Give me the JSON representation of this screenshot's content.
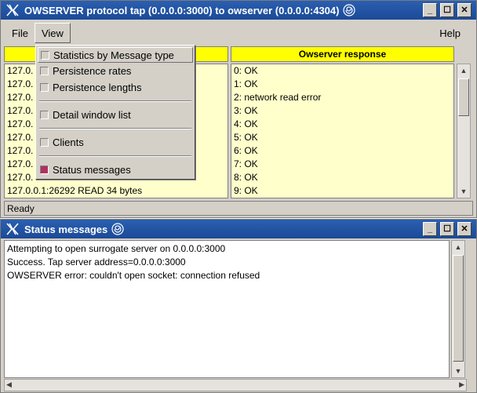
{
  "main_window": {
    "title": "OWSERVER protocol tap (0.0.0.0:3000) to owserver (0.0.0.0:4304)",
    "menu": {
      "file": "File",
      "view": "View",
      "help": "Help"
    },
    "columns": {
      "left_header": "",
      "right_header": "Owserver response"
    },
    "left_rows": [
      "127.0.",
      "127.0.",
      "127.0.",
      "127.0.",
      "127.0.",
      "127.0.",
      "127.0.",
      "127.0.",
      "127.0.",
      "127.0.0.1:26292 READ 34 bytes"
    ],
    "right_rows": [
      "0: OK",
      "1: OK",
      "2: network read error",
      "3: OK",
      "4: OK",
      "5: OK",
      "6: OK",
      "7: OK",
      "8: OK",
      "9: OK"
    ],
    "status": "Ready"
  },
  "view_menu": {
    "items": [
      {
        "label": "Statistics by Message type",
        "checked": false
      },
      {
        "label": "Persistence rates",
        "checked": false
      },
      {
        "label": "Persistence lengths",
        "checked": false
      },
      {
        "label": "Detail window list",
        "checked": false
      },
      {
        "label": "Clients",
        "checked": false
      },
      {
        "label": "Status messages",
        "checked": true
      }
    ]
  },
  "status_window": {
    "title": "Status messages",
    "lines": [
      "Attempting to open surrogate server on 0.0.0.0:3000",
      "Success. Tap server address=0.0.0.0:3000",
      "OWSERVER error: couldn't open socket: connection refused"
    ]
  },
  "colors": {
    "titlebar": "#2b5fb0",
    "header_yellow": "#ffff00",
    "list_bg": "#ffffcc",
    "checked": "#b03060"
  },
  "icons": {
    "app": "x-logo-icon",
    "title_swirl": "swirl-icon",
    "minimize": "minimize-icon",
    "maximize": "maximize-icon",
    "close": "close-icon"
  }
}
